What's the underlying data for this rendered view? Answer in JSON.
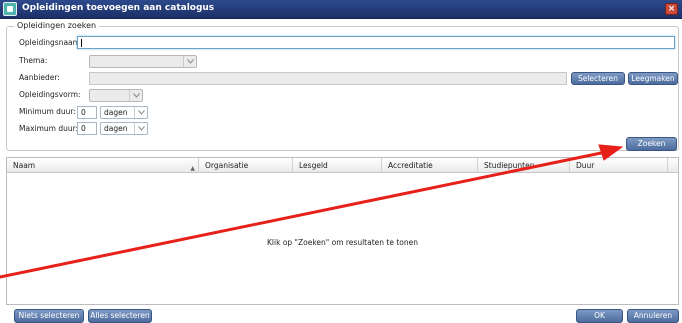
{
  "window": {
    "title": "Opleidingen toevoegen aan catalogus"
  },
  "search": {
    "legend": "Opleidingen zoeken",
    "opleidingsnaam_label": "Opleidingsnaam:",
    "opleidingsnaam_value": "",
    "thema_label": "Thema:",
    "thema_value": "",
    "aanbieder_label": "Aanbieder:",
    "aanbieder_value": "",
    "selecteren_label": "Selecteren",
    "leegmaken_label": "Leegmaken",
    "opleidingsvorm_label": "Opleidingsvorm:",
    "opleidingsvorm_value": "",
    "min_duur_label": "Minimum duur:",
    "min_duur_value": "0",
    "min_duur_unit": "dagen",
    "max_duur_label": "Maximum duur:",
    "max_duur_value": "0",
    "max_duur_unit": "dagen",
    "zoeken_label": "Zoeken"
  },
  "grid": {
    "columns": [
      "Naam",
      "Organisatie",
      "Lesgeld",
      "Accreditatie",
      "Studiepunten",
      "Duur"
    ],
    "empty_message": "Klik op \"Zoeken\" om resultaten te tonen"
  },
  "footer": {
    "niets_selecteren": "Niets selecteren",
    "alles_selecteren": "Alles selecteren",
    "ok": "OK",
    "annuleren": "Annuleren"
  },
  "colors": {
    "titlebar": "#1c3068",
    "button": "#5c7aab",
    "annotation_arrow": "#e8201a"
  },
  "icons": {
    "app": "app-icon",
    "close": "close-icon",
    "dropdown": "chevron-down-icon",
    "sort": "sort-ascending-icon"
  }
}
